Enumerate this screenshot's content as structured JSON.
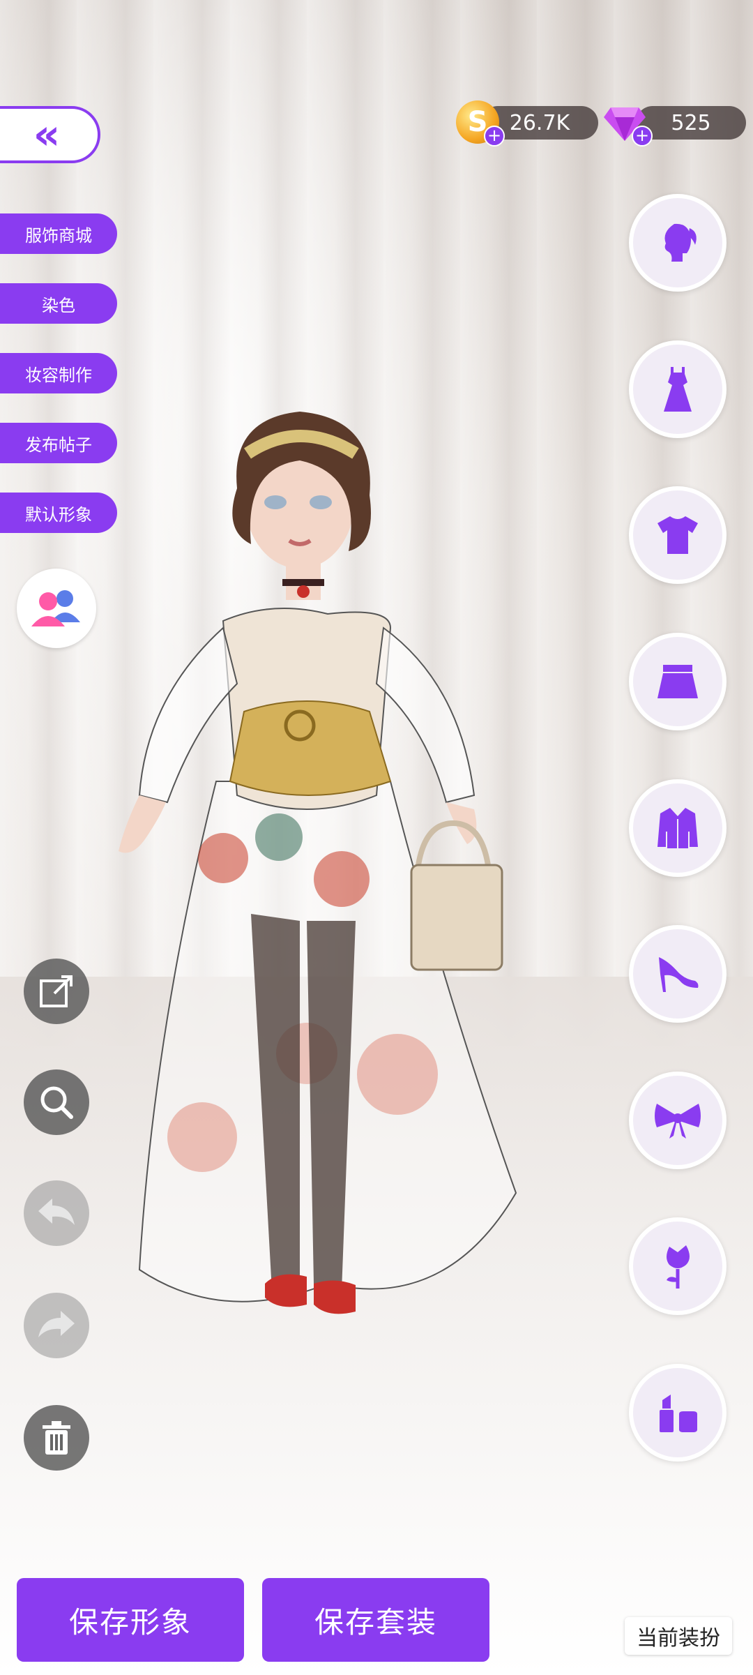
{
  "resources": {
    "coins": "26.7K",
    "gems": "525"
  },
  "colors": {
    "accent": "#8a3cf0",
    "button_text": "#ffffff"
  },
  "left_menu": [
    {
      "label": "服饰商城"
    },
    {
      "label": "染色"
    },
    {
      "label": "妆容制作"
    },
    {
      "label": "发布帖子"
    },
    {
      "label": "默认形象"
    }
  ],
  "right_categories": [
    {
      "icon": "hair-icon"
    },
    {
      "icon": "dress-icon"
    },
    {
      "icon": "top-icon"
    },
    {
      "icon": "skirt-icon"
    },
    {
      "icon": "jacket-icon"
    },
    {
      "icon": "heel-shoe-icon"
    },
    {
      "icon": "bow-icon"
    },
    {
      "icon": "rose-icon"
    },
    {
      "icon": "makeup-icon"
    }
  ],
  "tools": [
    {
      "icon": "share-icon"
    },
    {
      "icon": "zoom-icon"
    },
    {
      "icon": "undo-icon"
    },
    {
      "icon": "redo-icon"
    },
    {
      "icon": "trash-icon"
    }
  ],
  "bottom": {
    "save_look": "保存形象",
    "save_outfit": "保存套装",
    "current_outfit": "当前装扮"
  }
}
